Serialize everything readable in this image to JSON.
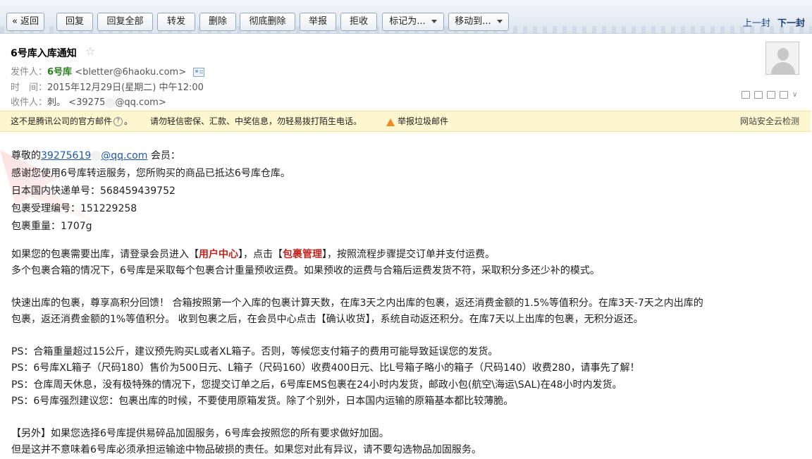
{
  "toolbar": {
    "back": "« 返回",
    "reply": "回复",
    "reply_all": "回复全部",
    "forward": "转发",
    "delete": "删除",
    "delete_permanent": "彻底删除",
    "report": "举报",
    "reject": "拒收",
    "mark_as": "标记为...",
    "move_to": "移动到...",
    "prev": "上一封",
    "next": "下一封"
  },
  "header": {
    "subject": "6号库入库通知",
    "from_label": "发件人：",
    "from_name": "6号库",
    "from_addr": "<bletter@6haoku.com>",
    "time_label": "时　间：",
    "time_value": "2015年12月29日(星期二) 中午12:00",
    "to_label": "收件人：",
    "to_name": "刺。",
    "to_addr_a": "<39275",
    "to_addr_b": "@qq.com>"
  },
  "notice": {
    "official": "这不是腾讯公司的官方邮件",
    "official_end": "。",
    "warning": "请勿轻信密保、汇款、中奖信息，勿轻易拨打陌生电话。",
    "report": "举报垃圾邮件",
    "security": "网站安全云检测"
  },
  "body": {
    "greet_prefix": "尊敬的",
    "email_a": "39275619",
    "email_b": "@qq.com",
    "greet_suffix": " 会员：",
    "l1": "感谢您使用6号库转运服务，您所购买的商品已抵达6号库仓库。",
    "l2": "日本国内快递单号：568459439752",
    "l3": "包裹受理编号：151229258",
    "l4": "包裹重量：1707g",
    "p1_a": "如果您的包裹需要出库，请登录会员进入【",
    "p1_b": "用户中心",
    "p1_c": "】，点击【",
    "p1_d": "包裹管理",
    "p1_e": "】，按照流程步骤提交订单并支付运费。",
    "p2": "多个包裹合箱的情况下，6号库是采取每个包裹合计重量预收运费。如果预收的运费与合箱后运费发货不符，采取积分多还少补的模式。",
    "p3": "快速出库的包裹，尊享高积分回馈！ 合箱按照第一个入库的包裹计算天数，在库3天之内出库的包裹，返还消费金额的1.5%等值积分。在库3天-7天之内出库的",
    "p4": "包裹，返还消费金额的1%等值积分。 收到包裹之后，在会员中心点击【确认收货】，系统自动返还积分。在库7天以上出库的包裹，无积分返还。",
    "ps1": "PS：合箱重量超过15公斤，建议预先购买L或者XL箱子。否则，等候您支付箱子的费用可能导致延误您的发货。",
    "ps2": "PS：6号库XL箱子（尺码180）售价为500日元、L箱子（尺码160）收费400日元、比L号箱子略小的箱子（尺码140）收费280，请事先了解！",
    "ps3": "PS：仓库周天休息，没有极特殊的情况下，您提交订单之后，6号库EMS包裹在24小时内发货，邮政小包(航空\\海运\\SAL)在48小时内发货。",
    "ps4": "PS：6号库强烈建议您：包裹出库的时候，不要使用原箱发货。除了个别外，日本国内运输的原箱基本都比较薄脆。",
    "x1": "【另外】如果您选择6号库提供易碎品加固服务，6号库会按照您的所有要求做好加固。",
    "x2": "但是这并不意味着6号库必须承担运输途中物品破损的责任。如果您对此有异议，请不要勾选物品加固服务。"
  }
}
